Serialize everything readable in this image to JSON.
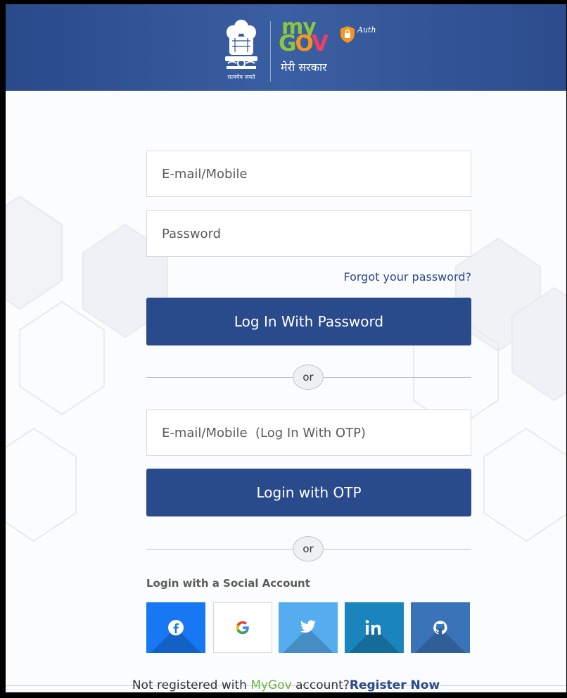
{
  "header": {
    "emblem_caption": "सत्यमेव जयते",
    "logo": {
      "my": "my",
      "gov_g": "G",
      "gov_o": "O",
      "gov_v": "V",
      "auth": "Auth",
      "tagline": "मेरी सरकार"
    },
    "colors": {
      "header_bg": "#2f5296",
      "green": "#8cc63f",
      "orange": "#f7941d",
      "pink": "#ee3e63"
    }
  },
  "login_form": {
    "email_placeholder": "E-mail/Mobile",
    "password_placeholder": "Password",
    "forgot_link": "Forgot your password?",
    "login_password_button": "Log In With Password",
    "separator_1": "or",
    "otp_placeholder": "E-mail/Mobile  (Log In With OTP)",
    "login_otp_button": "Login with OTP",
    "separator_2": "or"
  },
  "social": {
    "heading": "Login with a Social Account",
    "buttons": [
      {
        "name": "facebook",
        "icon": "facebook-icon",
        "color": "#1877f2"
      },
      {
        "name": "google",
        "icon": "google-icon",
        "color": "#ffffff"
      },
      {
        "name": "twitter",
        "icon": "twitter-icon",
        "color": "#55acee"
      },
      {
        "name": "linkedin",
        "icon": "linkedin-icon",
        "color": "#1a84bc"
      },
      {
        "name": "github",
        "icon": "github-icon",
        "color": "#3b73b9"
      }
    ]
  },
  "footer": {
    "text_before": "Not registered with ",
    "brand": "MyGov",
    "text_after": " account?",
    "register_link": "Register Now"
  },
  "colors": {
    "primary": "#294a8b",
    "border": "#d6d9de"
  }
}
